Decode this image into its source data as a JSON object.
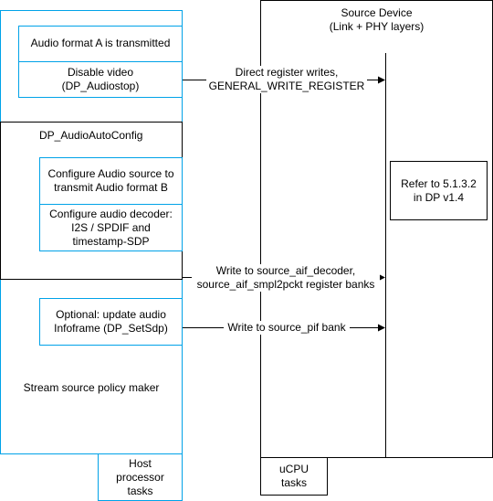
{
  "host": {
    "audio_a": "Audio format A is transmitted",
    "disable_video": "Disable video\n(DP_Audiostop)",
    "autoconfig_title": "DP_AudioAutoConfig",
    "configure_source": "Configure Audio source to\ntransmit Audio format B",
    "configure_decoder": "Configure audio decoder:\nI2S / SPDIF and\ntimestamp-SDP",
    "optional_infoframe": "Optional: update audio\nInfoframe (DP_SetSdp)",
    "policy_maker": "Stream source policy maker",
    "host_tasks": "Host\nprocessor\ntasks"
  },
  "device": {
    "title": "Source Device\n(Link + PHY layers)",
    "refer": "Refer to 5.1.3.2\nin DP v1.4",
    "ucpu_tasks": "uCPU\ntasks"
  },
  "arrows": {
    "direct_writes": "Direct register writes,\nGENERAL_WRITE_REGISTER",
    "aif_writes": "Write to source_aif_decoder,\nsource_aif_smpl2pckt register banks",
    "pif_write": "Write to source_pif bank"
  },
  "colors": {
    "host_border": "#00a2e8",
    "device_border": "#000000"
  }
}
